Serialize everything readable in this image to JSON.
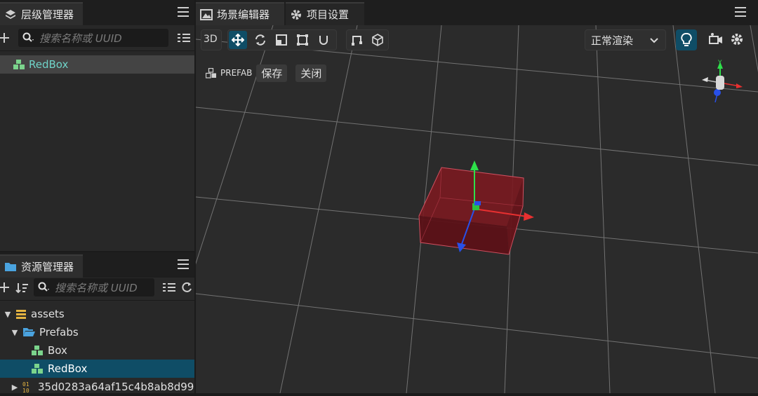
{
  "hierarchy": {
    "tab_label": "层级管理器",
    "search_placeholder": "搜索名称或 UUID",
    "items": [
      {
        "label": "RedBox"
      }
    ]
  },
  "assets": {
    "tab_label": "资源管理器",
    "search_placeholder": "搜索名称或 UUID",
    "tree": [
      {
        "label": "assets"
      },
      {
        "label": "Prefabs"
      },
      {
        "label": "Box"
      },
      {
        "label": "RedBox"
      },
      {
        "label": "35d0283a64af15c4b8ab8d99"
      }
    ]
  },
  "scene": {
    "tabs": [
      {
        "label": "场景编辑器"
      },
      {
        "label": "项目设置"
      }
    ],
    "toolbar": {
      "mode_3d": "3D",
      "render_mode": "正常渲染"
    },
    "prefab": {
      "label": "PREFAB",
      "save": "保存",
      "close": "关闭"
    },
    "gizmo_axis_y": "Y"
  },
  "colors": {
    "accent_teal": "#6fd3c8",
    "selection": "#0f4d66",
    "cube_red": "#8b1a22"
  }
}
